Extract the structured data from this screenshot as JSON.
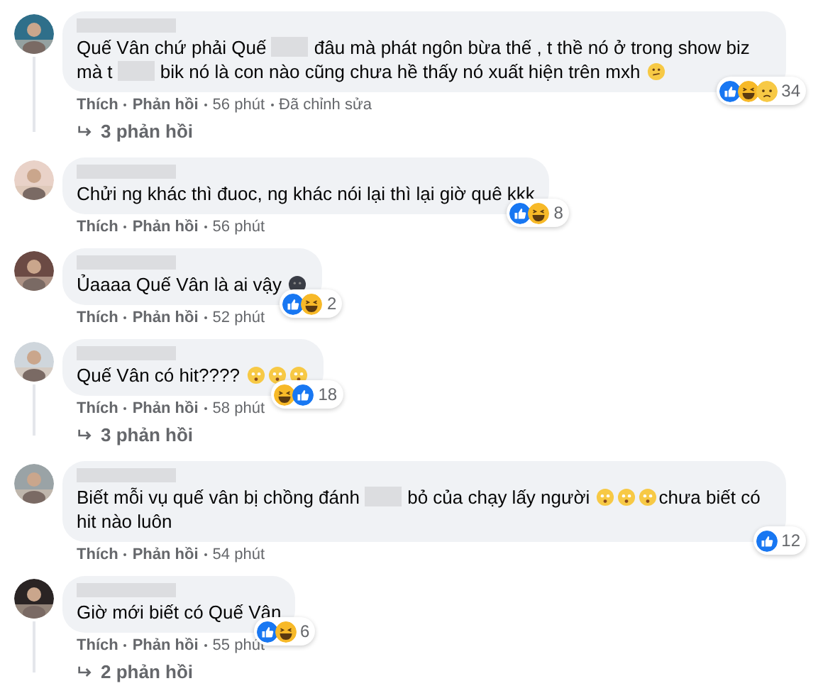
{
  "comments": [
    {
      "body": [
        {
          "kind": "text",
          "text": "Quế Vân chứ phải Quế"
        },
        {
          "kind": "blur"
        },
        {
          "kind": "text",
          "text": "đâu mà phát ngôn bừa thế , t thề nó ở trong show biz mà t"
        },
        {
          "kind": "blur"
        },
        {
          "kind": "text",
          "text": "bik nó là con nào cũng chưa hề thấy nó xuất hiện trên mxh"
        },
        {
          "kind": "thinking"
        }
      ],
      "reactions": [
        {
          "kind": "like"
        },
        {
          "kind": "haha"
        },
        {
          "kind": "sad"
        }
      ],
      "count": "34",
      "actions": [
        "Thích",
        "Phản hồi"
      ],
      "time": "56 phút",
      "edited": "Đã chỉnh sửa",
      "replies": "3 phản hồi"
    },
    {
      "body": [
        {
          "kind": "text",
          "text": "Chửi ng khác thì đuoc, ng khác nói lại thì lại giờ quê kkk"
        }
      ],
      "reactions": [
        {
          "kind": "like"
        },
        {
          "kind": "haha"
        }
      ],
      "count": "8",
      "actions": [
        "Thích",
        "Phản hồi"
      ],
      "time": "56 phút"
    },
    {
      "body": [
        {
          "kind": "text",
          "text": "Ủaaaa Quế Vân là ai vậy"
        },
        {
          "kind": "dark"
        }
      ],
      "reactions": [
        {
          "kind": "like"
        },
        {
          "kind": "haha"
        }
      ],
      "count": "2",
      "actions": [
        "Thích",
        "Phản hồi"
      ],
      "time": "52 phút"
    },
    {
      "body": [
        {
          "kind": "text",
          "text": "Quế Vân có hit????"
        },
        {
          "kind": "flushed"
        },
        {
          "kind": "flushed"
        },
        {
          "kind": "flushed"
        }
      ],
      "reactions": [
        {
          "kind": "haha"
        },
        {
          "kind": "like"
        }
      ],
      "count": "18",
      "actions": [
        "Thích",
        "Phản hồi"
      ],
      "time": "58 phút",
      "replies": "3 phản hồi"
    },
    {
      "body": [
        {
          "kind": "text",
          "text": "Biết mỗi vụ quế vân bị chồng đánh"
        },
        {
          "kind": "blur"
        },
        {
          "kind": "text",
          "text": "bỏ của chạy lấy người"
        },
        {
          "kind": "flushed"
        },
        {
          "kind": "flushed"
        },
        {
          "kind": "flushed"
        },
        {
          "kind": "text",
          "text": "chưa biết có hit nào luôn"
        }
      ],
      "reactions": [
        {
          "kind": "like"
        }
      ],
      "count": "12",
      "actions": [
        "Thích",
        "Phản hồi"
      ],
      "time": "54 phút"
    },
    {
      "body": [
        {
          "kind": "text",
          "text": "Giờ mới biết có Quế Vân"
        }
      ],
      "reactions": [
        {
          "kind": "like"
        },
        {
          "kind": "haha"
        }
      ],
      "count": "6",
      "actions": [
        "Thích",
        "Phản hồi"
      ],
      "time": "55 phút",
      "replies": "2 phản hồi"
    }
  ]
}
